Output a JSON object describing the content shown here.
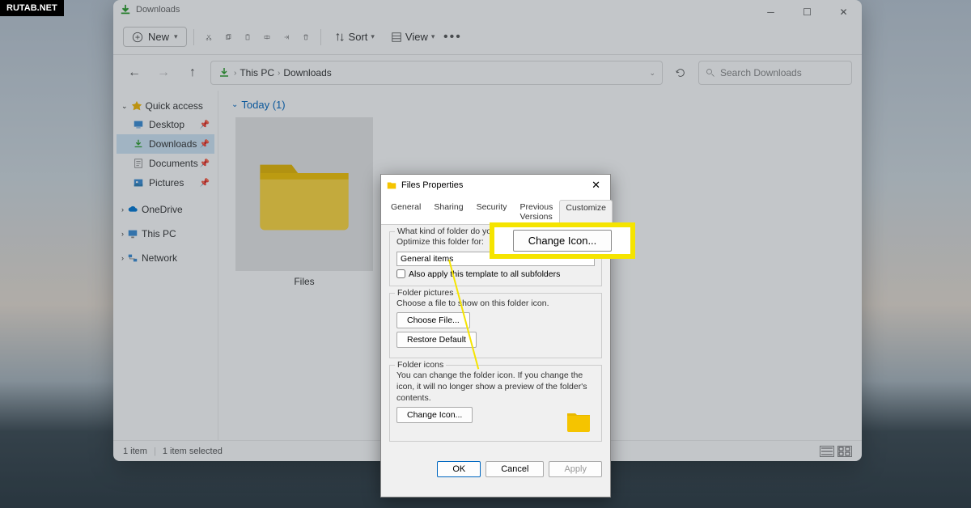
{
  "watermark": "RUTAB.NET",
  "titlebar": {
    "title": "Downloads"
  },
  "toolbar": {
    "new": "New",
    "sort": "Sort",
    "view": "View"
  },
  "breadcrumb": {
    "root": "This PC",
    "current": "Downloads"
  },
  "search": {
    "placeholder": "Search Downloads"
  },
  "sidebar": {
    "quick_access": "Quick access",
    "items": [
      {
        "label": "Desktop"
      },
      {
        "label": "Downloads"
      },
      {
        "label": "Documents"
      },
      {
        "label": "Pictures"
      }
    ],
    "onedrive": "OneDrive",
    "this_pc": "This PC",
    "network": "Network"
  },
  "main": {
    "group": "Today (1)",
    "folder_name": "Files"
  },
  "statusbar": {
    "count": "1 item",
    "selected": "1 item selected"
  },
  "props": {
    "title": "Files Properties",
    "tabs": {
      "general": "General",
      "sharing": "Sharing",
      "security": "Security",
      "previous": "Previous Versions",
      "customize": "Customize"
    },
    "folder_type": {
      "q1": "What kind of folder do you want?",
      "q2": "Optimize this folder for:",
      "select_value": "General items",
      "checkbox": "Also apply this template to all subfolders"
    },
    "folder_pictures": {
      "legend": "Folder pictures",
      "desc": "Choose a file to show on this folder icon.",
      "choose": "Choose File...",
      "restore": "Restore Default"
    },
    "folder_icons": {
      "legend": "Folder icons",
      "desc": "You can change the folder icon. If you change the icon, it will no longer show a preview of the folder's contents.",
      "change": "Change Icon..."
    },
    "footer": {
      "ok": "OK",
      "cancel": "Cancel",
      "apply": "Apply"
    }
  },
  "callout": {
    "label": "Change Icon..."
  }
}
